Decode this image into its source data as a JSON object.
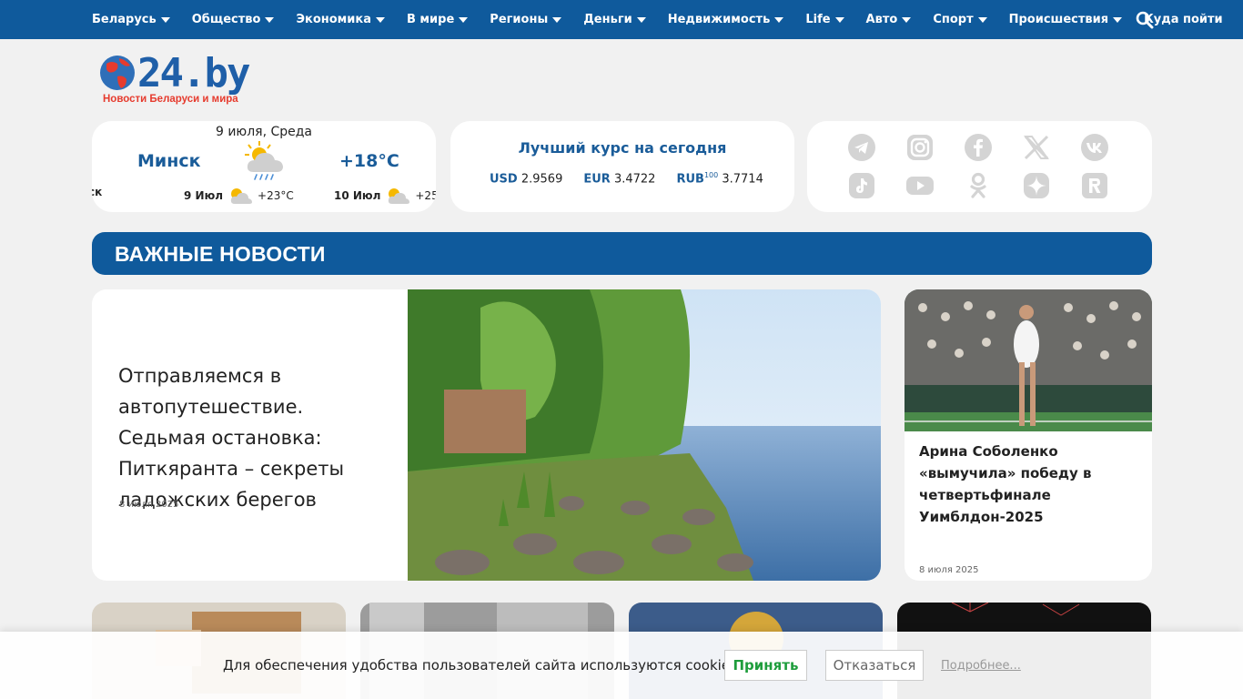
{
  "nav": {
    "items": [
      {
        "label": "Беларусь",
        "caret": true
      },
      {
        "label": "Общество",
        "caret": true
      },
      {
        "label": "Экономика",
        "caret": true
      },
      {
        "label": "В мире",
        "caret": true
      },
      {
        "label": "Регионы",
        "caret": true
      },
      {
        "label": "Деньги",
        "caret": true
      },
      {
        "label": "Недвижимость",
        "caret": true
      },
      {
        "label": "Life",
        "caret": true
      },
      {
        "label": "Авто",
        "caret": true
      },
      {
        "label": "Спорт",
        "caret": true
      },
      {
        "label": "Происшествия",
        "caret": true
      },
      {
        "label": "Куда пойти",
        "caret": false
      }
    ],
    "search_icon": "search-icon"
  },
  "logo": {
    "text": "24.by",
    "tagline": "Новости Беларуси и мира"
  },
  "weather": {
    "date": "9 июля, Среда",
    "city": "Минск",
    "temp": "+18°C",
    "forecast_cut_left": "ск",
    "forecast": [
      {
        "day": "9 Июл",
        "temp": "+23°C"
      },
      {
        "day": "10 Июл",
        "temp": "+25"
      }
    ]
  },
  "rates": {
    "title": "Лучший курс на сегодня",
    "items": [
      {
        "code": "USD",
        "sup": "",
        "value": "2.9569"
      },
      {
        "code": "EUR",
        "sup": "",
        "value": "3.4722"
      },
      {
        "code": "RUB",
        "sup": "100",
        "value": "3.7714"
      }
    ]
  },
  "social": {
    "icons": [
      "telegram-icon",
      "instagram-icon",
      "facebook-icon",
      "x-icon",
      "vk-icon",
      "tiktok-icon",
      "youtube-icon",
      "odnoklassniki-icon",
      "zen-icon",
      "rutube-icon"
    ],
    "color": "#d4d4d4"
  },
  "section": {
    "title": "ВАЖНЫЕ НОВОСТИ"
  },
  "main_news": {
    "title": "Отправляемся в автопутешествие. Седьмая остановка: Питкяранта – секреты ладожских берегов",
    "date": "8 июля 2025"
  },
  "side_news": {
    "title": "Арина Соболенко «вымучила» победу в четвертьфинале Уимблдон-2025",
    "date": "8 июля 2025"
  },
  "cookie": {
    "message": "Для обеспечения удобства пользователей сайта используются cookies.",
    "accept": "Принять",
    "decline": "Отказаться",
    "more": "Подробнее..."
  },
  "colors": {
    "brand": "#0f5a9c",
    "accent_text": "#1a5c99",
    "accept_green": "#1e9d3c"
  }
}
